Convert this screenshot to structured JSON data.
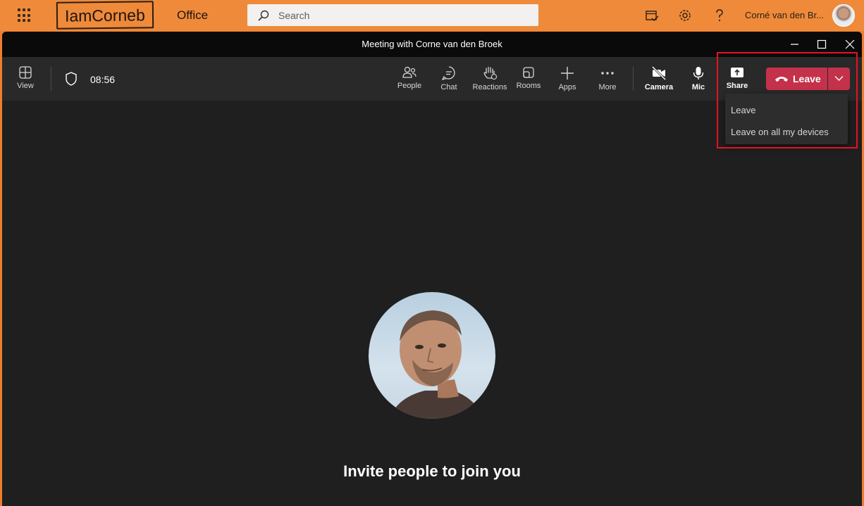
{
  "office": {
    "logo_text": "IamCorneb",
    "app_label": "Office",
    "search_placeholder": "Search",
    "user_name": "Corné van den Br..."
  },
  "window": {
    "title": "Meeting with Corne van den Broek"
  },
  "toolbar": {
    "view": "View",
    "timer": "08:56",
    "people": "People",
    "chat": "Chat",
    "reactions": "Reactions",
    "rooms": "Rooms",
    "apps": "Apps",
    "more": "More",
    "camera": "Camera",
    "mic": "Mic",
    "share": "Share",
    "leave": "Leave"
  },
  "leave_menu": {
    "items": [
      "Leave",
      "Leave on all my devices"
    ]
  },
  "stage": {
    "invite_text": "Invite people to join you"
  },
  "colors": {
    "office_bar": "#ee8a3a",
    "leave_red": "#c4314b",
    "highlight_red": "#e81123",
    "stage_bg": "#1f1f1f"
  }
}
